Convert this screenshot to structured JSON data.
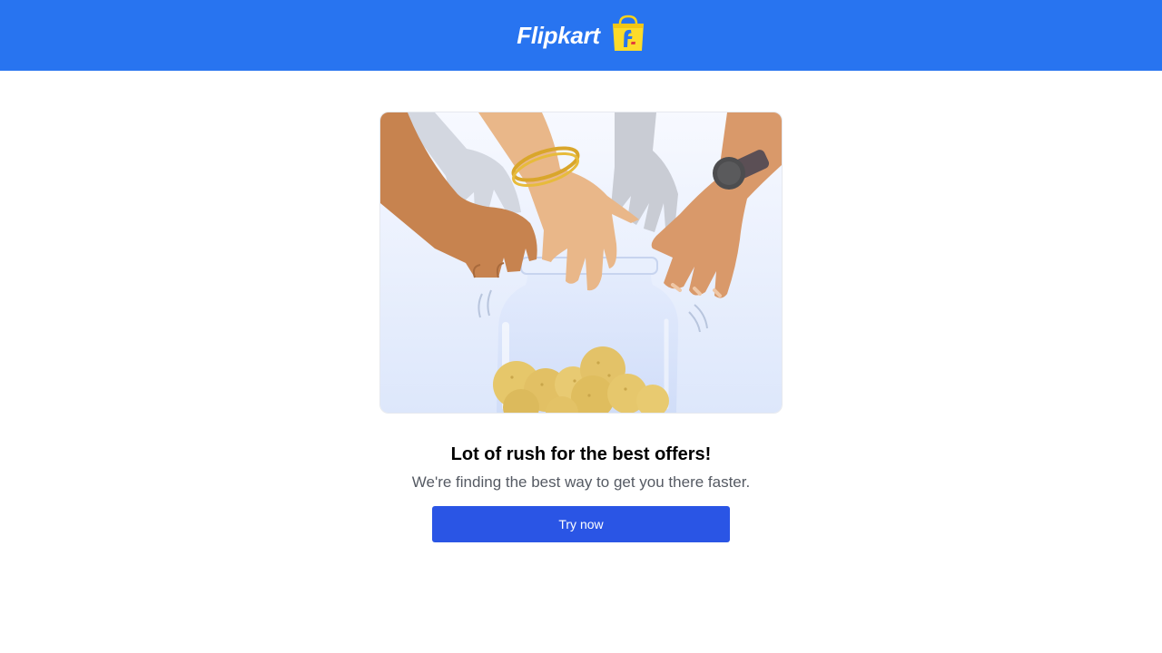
{
  "header": {
    "brand_name": "Flipkart",
    "brand_color": "#2874f0",
    "logo_icon": "flipkart-shopping-bag-icon"
  },
  "illustration": {
    "subject": "hands-reaching-into-jar-of-sweets"
  },
  "main": {
    "headline": "Lot of rush for the best offers!",
    "subtext": "We're finding the best way to get you there faster.",
    "cta_label": "Try now",
    "cta_color": "#2a55e5"
  }
}
